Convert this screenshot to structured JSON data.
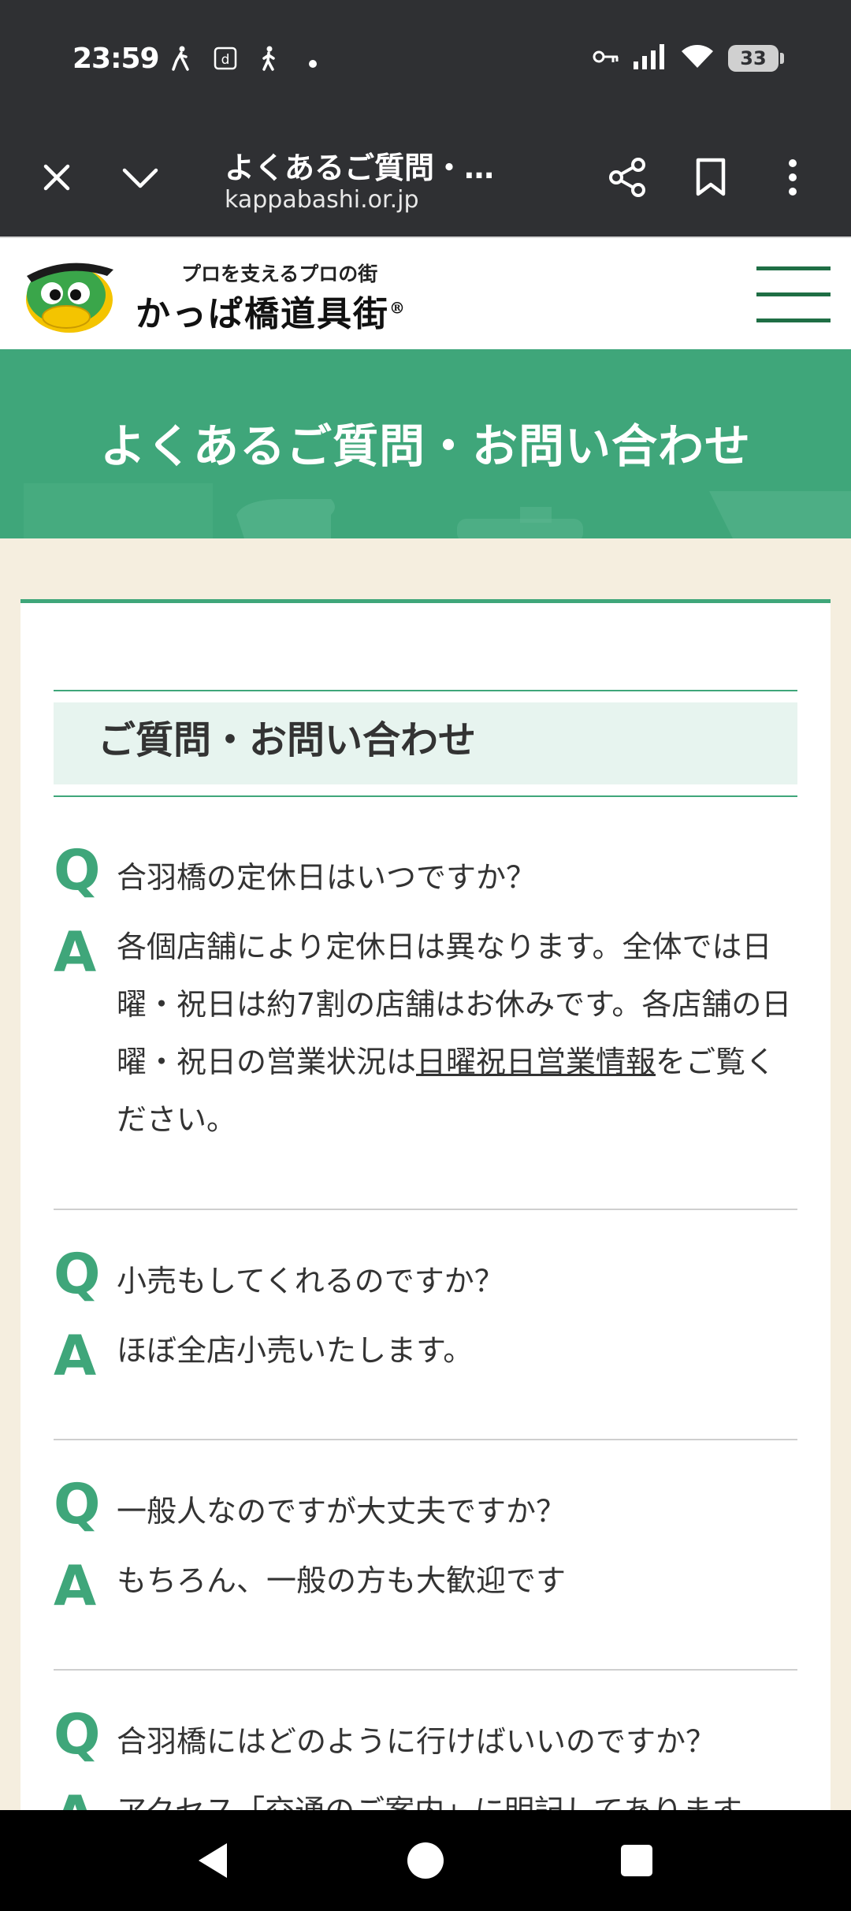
{
  "status_bar": {
    "time": "23:59",
    "battery": "33",
    "left_icons": [
      "walk-icon",
      "d-icon",
      "walk-icon",
      "dot-icon"
    ],
    "right_icons": [
      "key-icon",
      "signal-icon",
      "wifi-icon",
      "battery-icon"
    ]
  },
  "browser": {
    "title": "よくあるご質問・…",
    "url": "kappabashi.or.jp"
  },
  "site": {
    "tagline": "プロを支えるプロの街",
    "logo_text": "かっぱ橋道具街",
    "registered": "®"
  },
  "hero": {
    "title": "よくあるご質問・お問い合わせ"
  },
  "section": {
    "title": "ご質問・お問い合わせ"
  },
  "faq": [
    {
      "q": "合羽橋の定休日はいつですか？",
      "a_before": "各個店舗により定休日は異なります。全体では日曜・祝日は約7割の店舗はお休みです。各店舗の日曜・祝日の営業状況は",
      "a_link": "日曜祝日営業情報",
      "a_after": "をご覧ください。"
    },
    {
      "q": "小売もしてくれるのですか？",
      "a": "ほぼ全店小売いたします。"
    },
    {
      "q": "一般人なのですが大丈夫ですか？",
      "a": "もちろん、一般の方も大歓迎です"
    },
    {
      "q": "合羽橋にはどのように行けばいいのですか？",
      "a": "アクセス「交通のご案内」に明記してあります"
    }
  ],
  "labels": {
    "q": "Q",
    "a": "A"
  },
  "colors": {
    "accent": "#3fa67a",
    "dark_green": "#1f6e45",
    "cream": "#f5eedf",
    "chrome": "#2f3033"
  }
}
